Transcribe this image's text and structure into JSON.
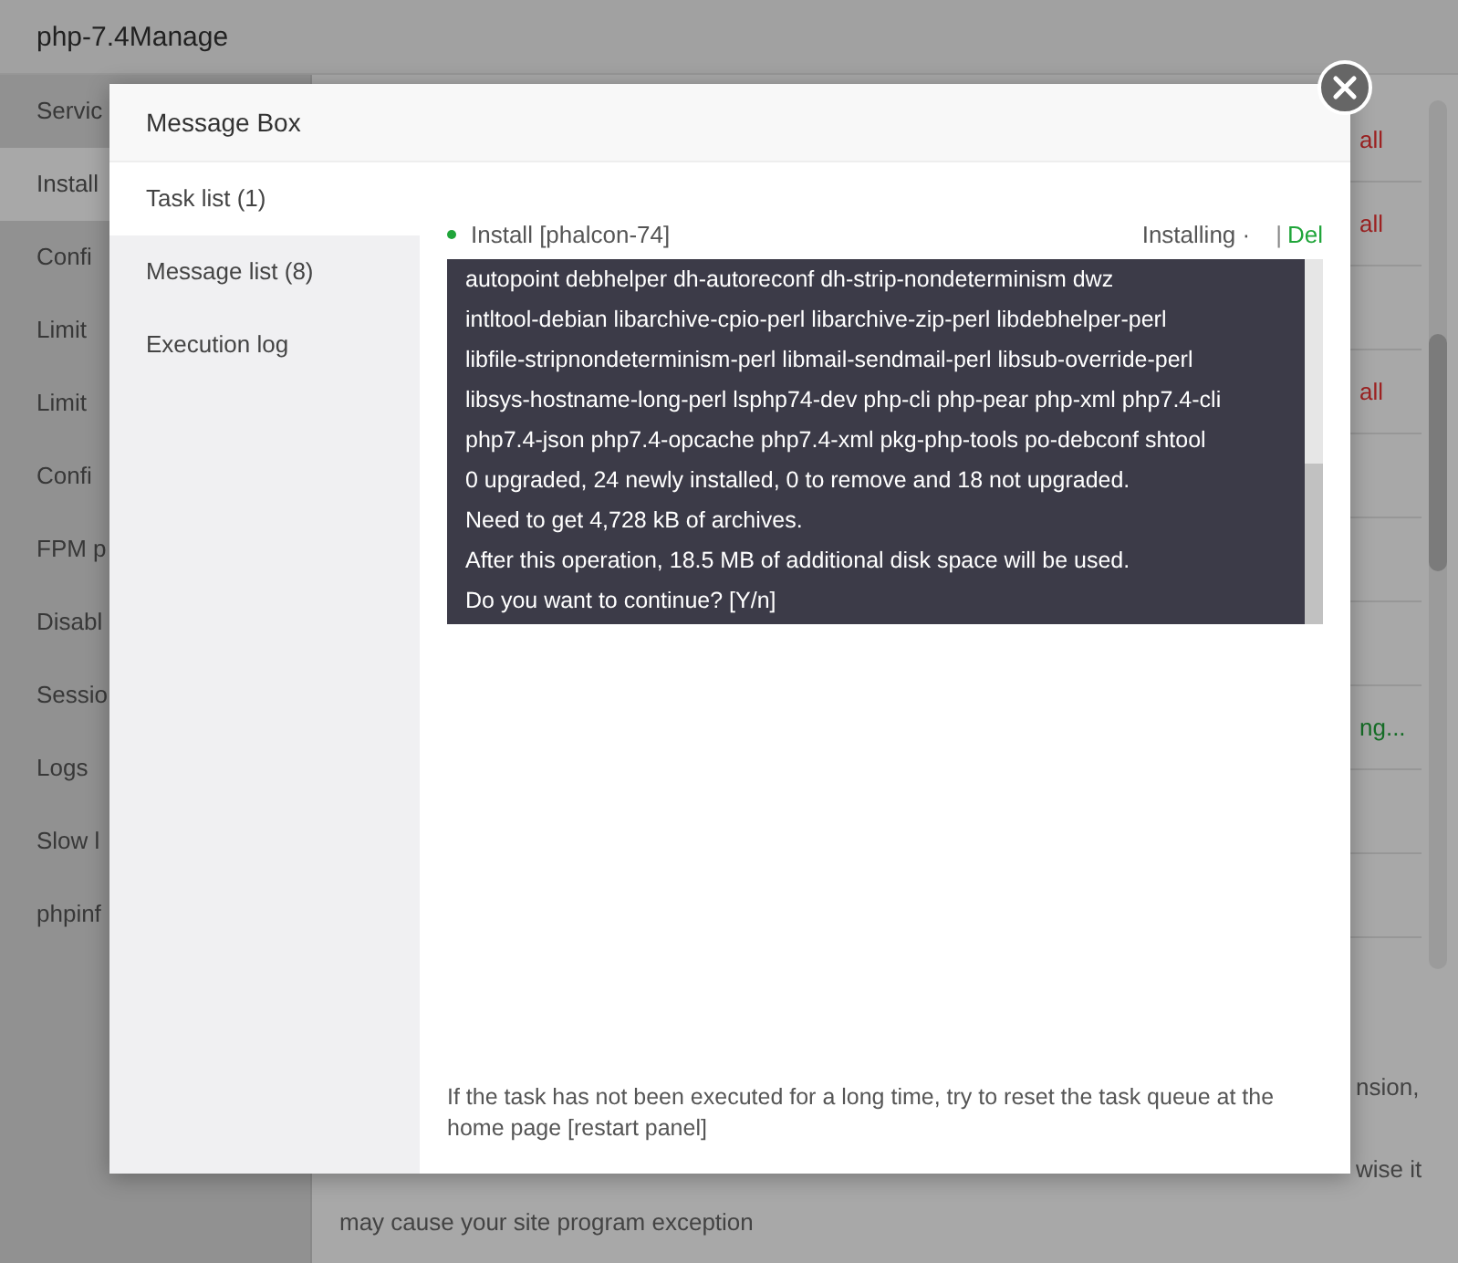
{
  "page": {
    "title": "php-7.4Manage",
    "sidebar": [
      {
        "label": "Servic",
        "selected": false
      },
      {
        "label": "Install",
        "selected": true
      },
      {
        "label": "Confi",
        "selected": false
      },
      {
        "label": "Limit",
        "selected": false
      },
      {
        "label": "Limit",
        "selected": false
      },
      {
        "label": "Confi",
        "selected": false
      },
      {
        "label": "FPM p",
        "selected": false
      },
      {
        "label": "Disabl",
        "selected": false
      },
      {
        "label": "Sessio",
        "selected": false
      },
      {
        "label": "Logs",
        "selected": false
      },
      {
        "label": "Slow l",
        "selected": false
      },
      {
        "label": "phpinf",
        "selected": false
      }
    ],
    "rows": [
      {
        "kind": "danger",
        "text": "all"
      },
      {
        "kind": "danger",
        "text": "all"
      },
      {
        "kind": "blank"
      },
      {
        "kind": "danger",
        "text": "all"
      },
      {
        "kind": "blank"
      },
      {
        "kind": "blank"
      },
      {
        "kind": "blank"
      },
      {
        "kind": "success",
        "text": "ng..."
      },
      {
        "kind": "blank"
      },
      {
        "kind": "blank"
      }
    ],
    "notes": [
      "nsion,",
      "wise it"
    ],
    "note_tail": "may cause your site program exception"
  },
  "modal": {
    "title": "Message Box",
    "tabs": [
      {
        "label": "Task list (1)",
        "selected": true
      },
      {
        "label": "Message list (8)",
        "selected": false
      },
      {
        "label": "Execution log",
        "selected": false
      }
    ],
    "task": {
      "name": "Install [phalcon-74]",
      "status": "Installing ·",
      "separator": "|",
      "action": "Del"
    },
    "log": [
      "autopoint debhelper dh-autoreconf dh-strip-nondeterminism dwz",
      "intltool-debian libarchive-cpio-perl libarchive-zip-perl libdebhelper-perl",
      "libfile-stripnondeterminism-perl libmail-sendmail-perl libsub-override-perl",
      "libsys-hostname-long-perl lsphp74-dev php-cli php-pear php-xml php7.4-cli",
      "php7.4-json php7.4-opcache php7.4-xml pkg-php-tools po-debconf shtool",
      "0 upgraded, 24 newly installed, 0 to remove and 18 not upgraded.",
      "Need to get 4,728 kB of archives.",
      "After this operation, 18.5 MB of additional disk space will be used.",
      "Do you want to continue? [Y/n]"
    ],
    "footer": "If the task has not been executed for a long time, try to reset the task queue at the home page [restart panel]"
  }
}
